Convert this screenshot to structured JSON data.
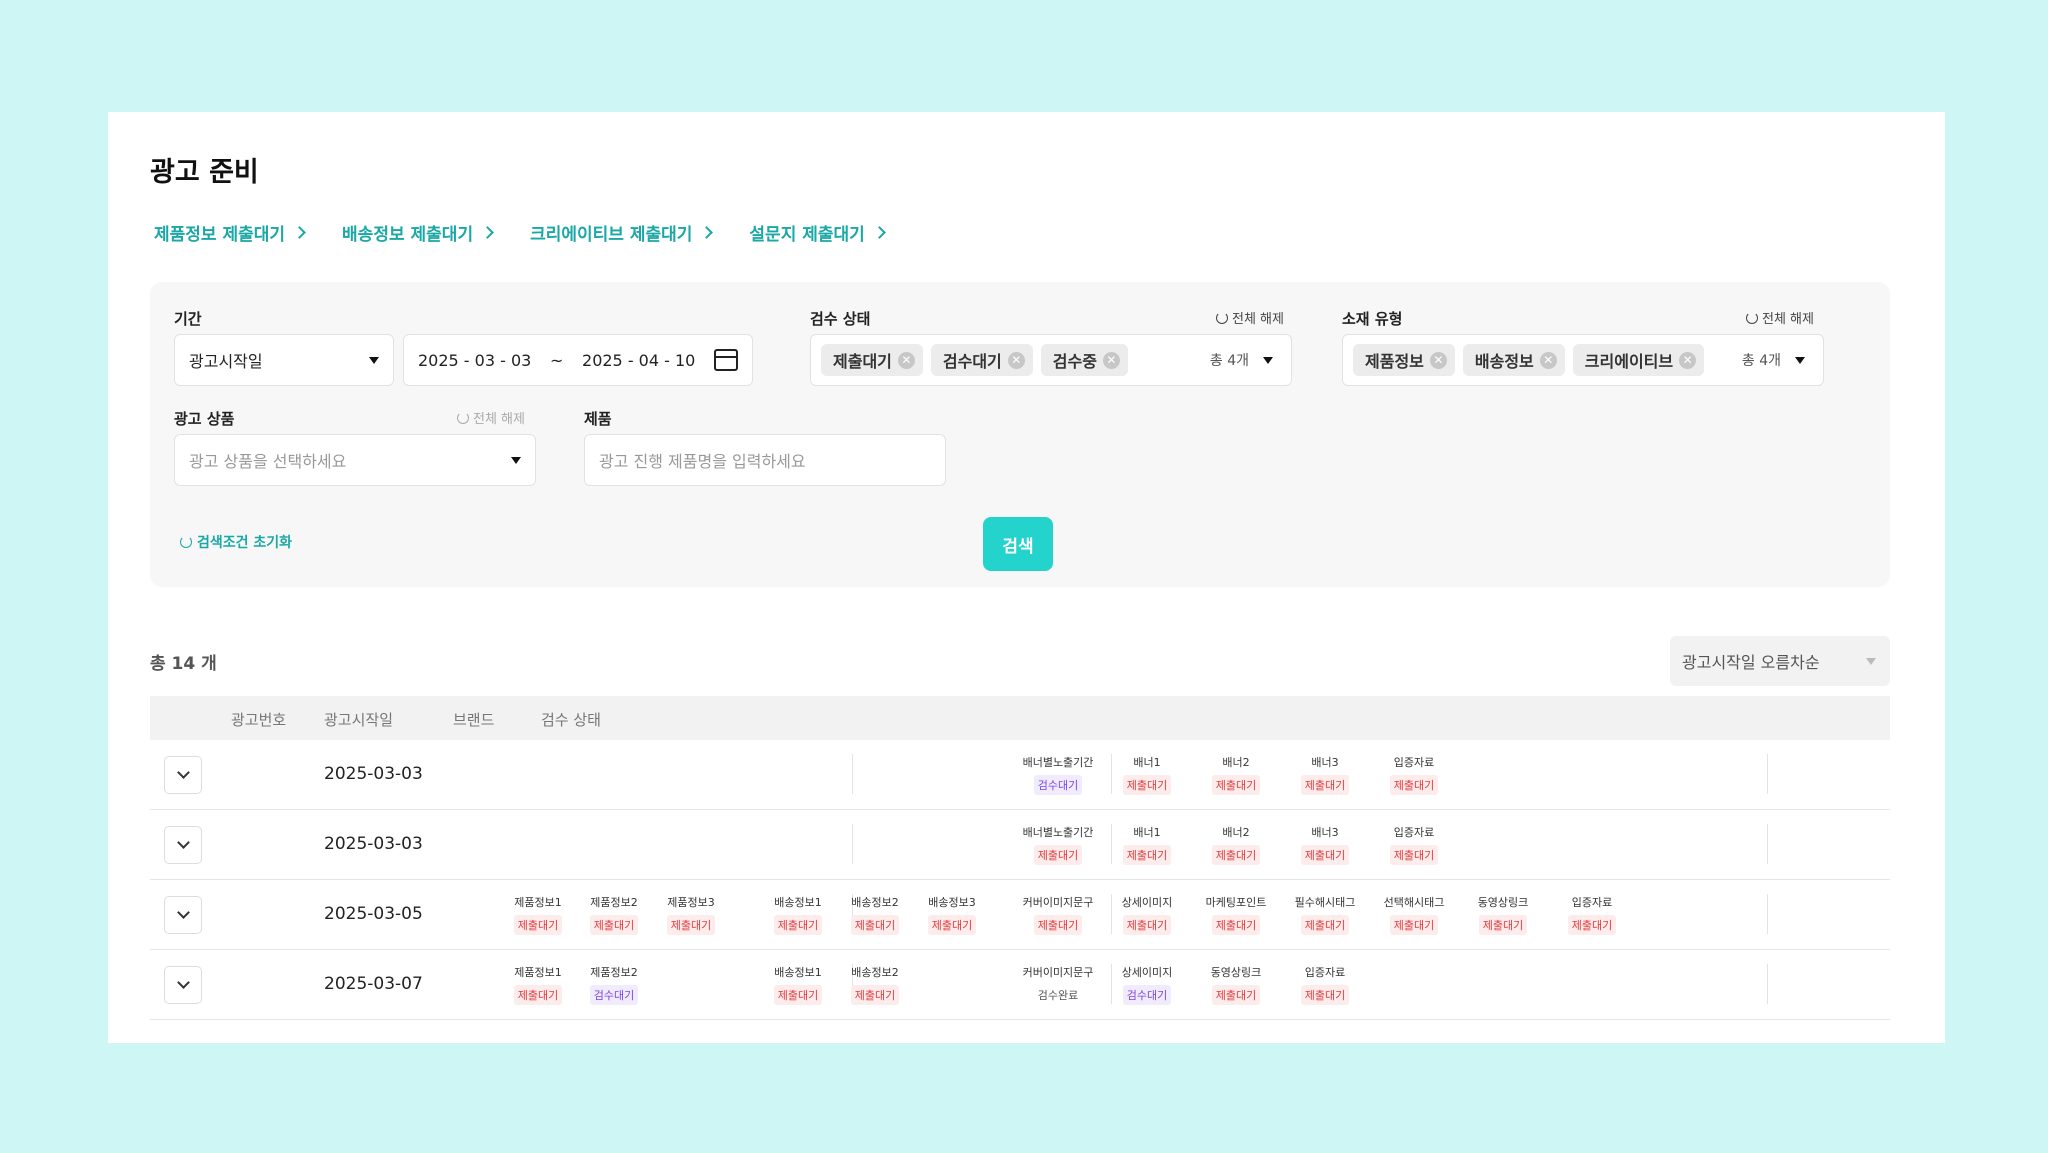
{
  "page": {
    "title": "광고 준비"
  },
  "links": [
    "제품정보 제출대기",
    "배송정보 제출대기",
    "크리에이티브 제출대기",
    "설문지 제출대기"
  ],
  "filters": {
    "period": {
      "label": "기간",
      "type_value": "광고시작일",
      "start": "2025 - 03 - 03",
      "sep": "~",
      "end": "2025 - 04 - 10"
    },
    "review": {
      "label": "검수 상태",
      "reset": "전체 해제",
      "chips": [
        "제출대기",
        "검수대기",
        "검수중"
      ],
      "total": "총 4개"
    },
    "material": {
      "label": "소재 유형",
      "reset": "전체 해제",
      "chips": [
        "제품정보",
        "배송정보",
        "크리에이티브"
      ],
      "total": "총 4개"
    },
    "product_ad": {
      "label": "광고 상품",
      "reset": "전체 해제",
      "placeholder": "광고 상품을 선택하세요"
    },
    "product": {
      "label": "제품",
      "placeholder": "광고 진행 제품명을 입력하세요"
    },
    "reset_all": "검색조건 초기화",
    "search": "검색"
  },
  "results": {
    "count": "총 14 개",
    "sort": "광고시작일 오름차순",
    "headers": [
      "광고번호",
      "광고시작일",
      "브랜드",
      "검수 상태"
    ],
    "rows": [
      {
        "date": "2025-03-03",
        "product": [],
        "shipping": [],
        "creative": [
          {
            "n": "배너별노출기간",
            "s": "검수대기",
            "c": "purple"
          },
          {
            "n": "배너1",
            "s": "제출대기",
            "c": "red"
          },
          {
            "n": "배너2",
            "s": "제출대기",
            "c": "red"
          },
          {
            "n": "배너3",
            "s": "제출대기",
            "c": "red"
          },
          {
            "n": "입증자료",
            "s": "제출대기",
            "c": "red"
          }
        ]
      },
      {
        "date": "2025-03-03",
        "product": [],
        "shipping": [],
        "creative": [
          {
            "n": "배너별노출기간",
            "s": "제출대기",
            "c": "red"
          },
          {
            "n": "배너1",
            "s": "제출대기",
            "c": "red"
          },
          {
            "n": "배너2",
            "s": "제출대기",
            "c": "red"
          },
          {
            "n": "배너3",
            "s": "제출대기",
            "c": "red"
          },
          {
            "n": "입증자료",
            "s": "제출대기",
            "c": "red"
          }
        ]
      },
      {
        "date": "2025-03-05",
        "product": [
          {
            "n": "제품정보1",
            "s": "제출대기",
            "c": "red"
          },
          {
            "n": "제품정보2",
            "s": "제출대기",
            "c": "red"
          },
          {
            "n": "제품정보3",
            "s": "제출대기",
            "c": "red"
          }
        ],
        "shipping": [
          {
            "n": "배송정보1",
            "s": "제출대기",
            "c": "red"
          },
          {
            "n": "배송정보2",
            "s": "제출대기",
            "c": "red"
          },
          {
            "n": "배송정보3",
            "s": "제출대기",
            "c": "red"
          }
        ],
        "creative": [
          {
            "n": "커버이미지문구",
            "s": "제출대기",
            "c": "red"
          },
          {
            "n": "상세이미지",
            "s": "제출대기",
            "c": "red"
          },
          {
            "n": "마케팅포인트",
            "s": "제출대기",
            "c": "red"
          },
          {
            "n": "필수해시태그",
            "s": "제출대기",
            "c": "red"
          },
          {
            "n": "선택해시태그",
            "s": "제출대기",
            "c": "red"
          },
          {
            "n": "동영상링크",
            "s": "제출대기",
            "c": "red"
          },
          {
            "n": "입증자료",
            "s": "제출대기",
            "c": "red"
          }
        ]
      },
      {
        "date": "2025-03-07",
        "product": [
          {
            "n": "제품정보1",
            "s": "제출대기",
            "c": "red"
          },
          {
            "n": "제품정보2",
            "s": "검수대기",
            "c": "purple"
          }
        ],
        "shipping": [
          {
            "n": "배송정보1",
            "s": "제출대기",
            "c": "red"
          },
          {
            "n": "배송정보2",
            "s": "제출대기",
            "c": "red"
          }
        ],
        "creative": [
          {
            "n": "커버이미지문구",
            "s": "검수완료",
            "c": "gray"
          },
          {
            "n": "상세이미지",
            "s": "검수대기",
            "c": "purple"
          },
          {
            "n": "동영상링크",
            "s": "제출대기",
            "c": "red"
          },
          {
            "n": "입증자료",
            "s": "제출대기",
            "c": "red"
          }
        ]
      }
    ]
  },
  "colors": {
    "accent": "#1aa8a6",
    "search_button": "#23d3cc",
    "background": "#cdf6f4"
  },
  "icons": [
    "chevron-right-icon",
    "calendar-icon",
    "refresh-icon",
    "remove-chip-icon",
    "caret-down-icon",
    "chevron-down-icon"
  ]
}
